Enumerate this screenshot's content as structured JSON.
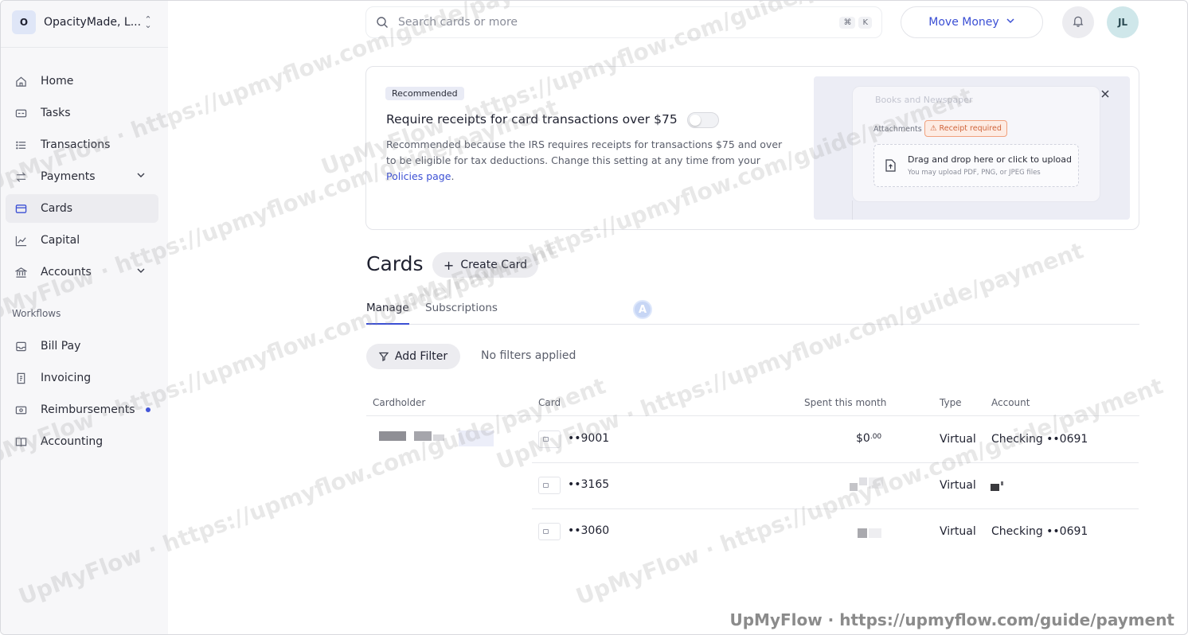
{
  "org": {
    "initial": "O",
    "name": "OpacityMade, L..."
  },
  "nav": {
    "items": [
      {
        "label": "Home"
      },
      {
        "label": "Tasks"
      },
      {
        "label": "Transactions"
      },
      {
        "label": "Payments"
      },
      {
        "label": "Cards"
      },
      {
        "label": "Capital"
      },
      {
        "label": "Accounts"
      }
    ],
    "workflows_label": "Workflows",
    "workflows": [
      {
        "label": "Bill Pay"
      },
      {
        "label": "Invoicing"
      },
      {
        "label": "Reimbursements"
      },
      {
        "label": "Accounting"
      }
    ]
  },
  "search": {
    "placeholder": "Search cards or more",
    "shortcut_cmd": "⌘",
    "shortcut_key": "K"
  },
  "header": {
    "move_money_label": "Move Money",
    "avatar_initials": "JL"
  },
  "banner": {
    "badge": "Recommended",
    "title": "Require receipts for card transactions over $75",
    "description": "Recommended because the IRS requires receipts for transactions $75 and over to be eligible for tax deductions. Change this setting at any time from your ",
    "link_text": "Policies page",
    "link_suffix": ".",
    "toggle_on": false,
    "illustration": {
      "field_placeholder": "Books and Newspaper",
      "attachments_label": "Attachments",
      "receipt_badge": "Receipt required",
      "drop_title": "Drag and drop here or click to upload",
      "drop_subtitle": "You may upload PDF, PNG, or JPEG files"
    }
  },
  "cards_section": {
    "title": "Cards",
    "create_label": "Create Card",
    "tabs": [
      {
        "label": "Manage"
      },
      {
        "label": "Subscriptions"
      }
    ],
    "ai_badge": "A",
    "add_filter_label": "Add Filter",
    "filter_status": "No filters applied"
  },
  "table": {
    "columns": [
      "Cardholder",
      "Card",
      "Spent this month",
      "Type",
      "Account"
    ],
    "rows": [
      {
        "card": "••9001",
        "spent_whole": "$0",
        "spent_cents": ".00",
        "type": "Virtual",
        "account": "Checking ••0691"
      },
      {
        "card": "••3165",
        "spent_whole": "",
        "spent_cents": "",
        "type": "Virtual",
        "account": ""
      },
      {
        "card": "••3060",
        "spent_whole": "",
        "spent_cents": "",
        "type": "Virtual",
        "account": "Checking ••0691"
      }
    ]
  },
  "watermark": {
    "text": "UpMyFlow · https://upmyflow.com/guide/payment",
    "footer": "UpMyFlow · https://upmyflow.com/guide/payment"
  }
}
